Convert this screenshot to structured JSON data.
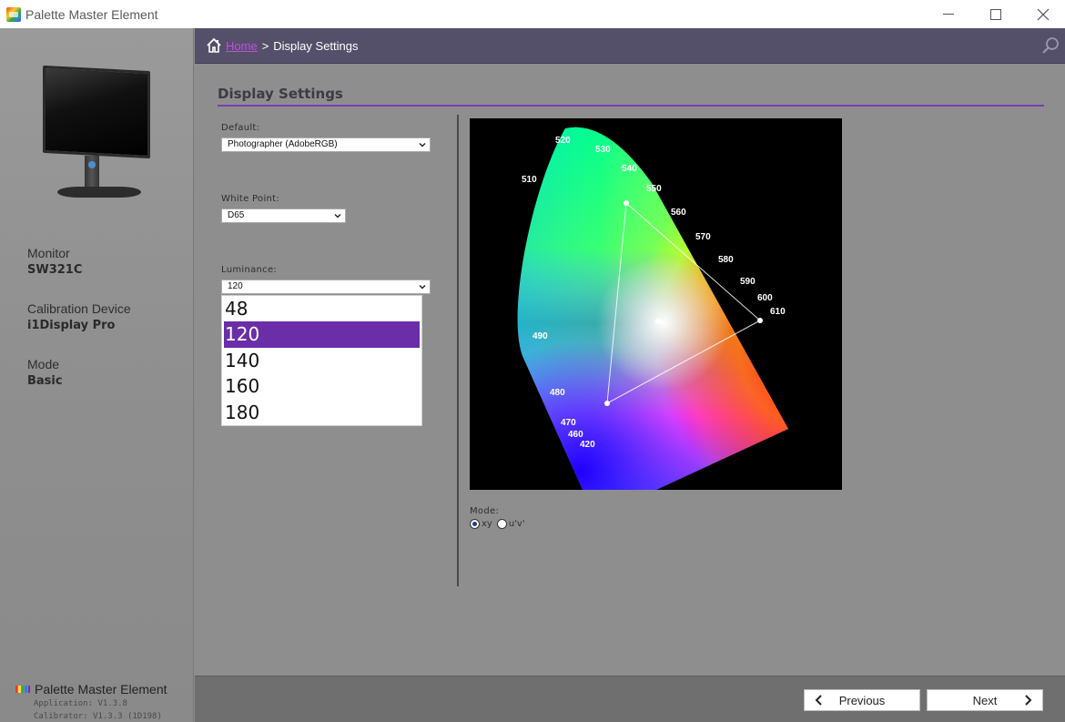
{
  "window": {
    "title": "Palette Master Element",
    "minimize": "–",
    "maximize": "□",
    "close": "✕"
  },
  "sidebar": {
    "monitor_label": "Monitor",
    "monitor_value": "SW321C",
    "device_label": "Calibration Device",
    "device_value": "i1Display Pro",
    "mode_label": "Mode",
    "mode_value": "Basic",
    "brand": "Palette Master Element",
    "application_version": "Application: V1.3.8",
    "calibrator_version": "Calibrator: V1.3.3 (1D198)"
  },
  "breadcrumb": {
    "home": "Home",
    "separator": ">",
    "current": "Display Settings"
  },
  "page": {
    "title": "Display Settings"
  },
  "fields": {
    "default_label": "Default:",
    "default_value": "Photographer (AdobeRGB)",
    "white_point_label": "White Point:",
    "white_point_value": "D65",
    "luminance_label": "Luminance:",
    "luminance_value": "120",
    "luminance_options": [
      "48",
      "120",
      "140",
      "160",
      "180"
    ],
    "luminance_selected_index": 1
  },
  "chart": {
    "wavelength_labels": [
      "520",
      "530",
      "540",
      "550",
      "560",
      "570",
      "580",
      "590",
      "600",
      "610",
      "510",
      "490",
      "480",
      "470",
      "460",
      "420"
    ],
    "mode_label": "Mode:",
    "mode_options": [
      "xy",
      "u'v'"
    ],
    "mode_selected": "xy"
  },
  "footer": {
    "previous": "Previous",
    "next": "Next"
  },
  "colors": {
    "accent_purple": "#6a2ea8",
    "header_bg": "#54506a",
    "link": "#c04fe0"
  }
}
